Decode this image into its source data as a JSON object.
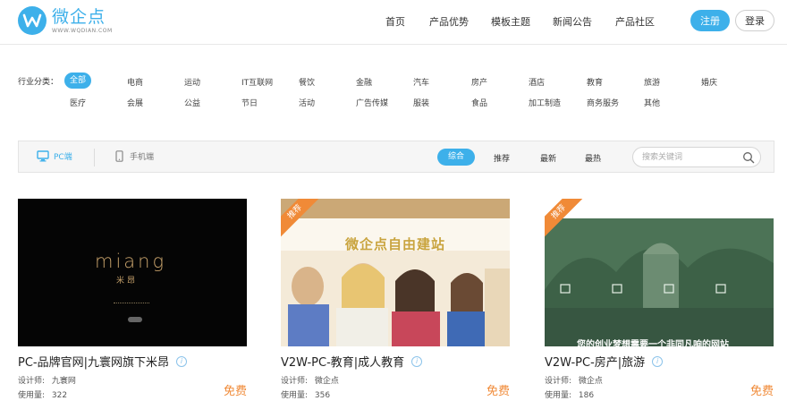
{
  "header": {
    "logo_name": "微企点",
    "logo_domain": "WWW.WQDIAN.COM",
    "nav": [
      "首页",
      "产品优势",
      "模板主题",
      "新闻公告",
      "产品社区"
    ],
    "register": "注册",
    "login": "登录"
  },
  "industry": {
    "label": "行业分类：",
    "row1": [
      "全部",
      "电商",
      "运动",
      "IT互联网",
      "餐饮",
      "金融",
      "汽车",
      "房产",
      "酒店",
      "教育",
      "旅游",
      "婚庆"
    ],
    "row2": [
      "医疗",
      "会展",
      "公益",
      "节日",
      "活动",
      "广告传媒",
      "服装",
      "食品",
      "加工制造",
      "商务服务",
      "其他"
    ],
    "active": "全部"
  },
  "filter": {
    "pc_label": "PC端",
    "mobile_label": "手机端",
    "sort": [
      "综合",
      "推荐",
      "最新",
      "最热"
    ],
    "active_sort": "综合",
    "search_placeholder": "搜索关键词"
  },
  "cards": [
    {
      "title": "PC-品牌官网|九寰网旗下米昂",
      "designer_label": "设计师:",
      "designer": "九寰网",
      "usage_label": "使用量:",
      "usage": "322",
      "price": "免费",
      "thumb_logo": "miang",
      "thumb_logo_cn": "米昂",
      "recommended": false
    },
    {
      "title": "V2W-PC-教育|成人教育",
      "designer_label": "设计师:",
      "designer": "微企点",
      "usage_label": "使用量:",
      "usage": "356",
      "price": "免费",
      "thumb_headline": "微企点自由建站",
      "ribbon": "推荐",
      "recommended": true
    },
    {
      "title": "V2W-PC-房产|旅游",
      "designer_label": "设计师:",
      "designer": "微企点",
      "usage_label": "使用量:",
      "usage": "186",
      "price": "免费",
      "thumb_headline": "您的创业梦想需要一个非同凡响的网站",
      "ribbon": "推荐",
      "recommended": true
    }
  ],
  "colors": {
    "accent": "#3db0ea",
    "price": "#f08a37"
  }
}
